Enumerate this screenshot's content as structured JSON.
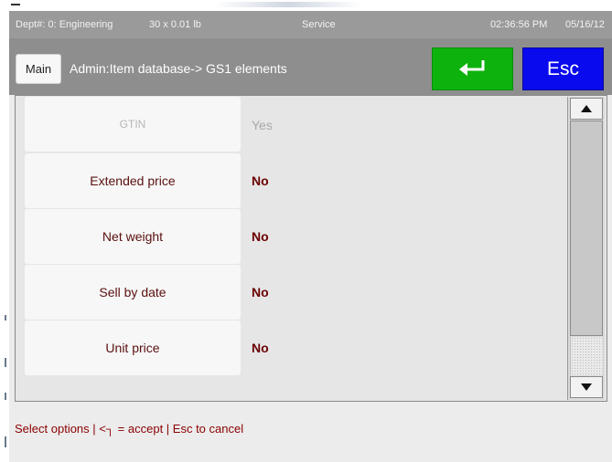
{
  "status_bar": {
    "department": "Dept#: 0: Engineering",
    "scale": "30 x 0.01 lb",
    "mode": "Service",
    "time": "02:36:56 PM",
    "date": "05/16/12"
  },
  "title_bar": {
    "main_button": "Main",
    "breadcrumb": "Admin:Item database-> GS1 elements",
    "enter_icon": "enter-return-arrow",
    "esc_button": "Esc"
  },
  "rows": [
    {
      "label": "GTIN",
      "value": "Yes",
      "enabled": false
    },
    {
      "label": "Extended price",
      "value": "No",
      "enabled": true
    },
    {
      "label": "Net weight",
      "value": "No",
      "enabled": true
    },
    {
      "label": "Sell by date",
      "value": "No",
      "enabled": true
    },
    {
      "label": "Unit price",
      "value": "No",
      "enabled": true
    }
  ],
  "scrollbar": {
    "up_icon": "triangle-up-icon",
    "down_icon": "triangle-down-icon"
  },
  "footer": {
    "hint": "Select options | <┐ = accept | Esc to cancel"
  },
  "colors": {
    "enter_button": "#0db20d",
    "esc_button": "#0a0aee",
    "row_label": "#5a1010",
    "value_text": "#6a0000",
    "footer_text": "#8a0000"
  }
}
